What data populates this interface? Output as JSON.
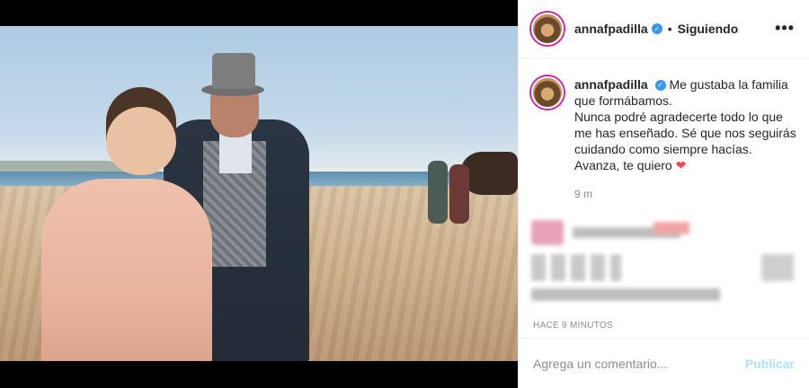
{
  "header": {
    "username": "annafpadilla",
    "separator": "•",
    "follow_label": "Siguiendo",
    "more_label": "•••"
  },
  "caption": {
    "username": "annafpadilla",
    "text": "Me gustaba la familia que formábamos.",
    "text2": "Nunca podré agradecerte todo lo que me has enseñado. Sé que nos seguirás cuidando como siempre hacías. Avanza, te quiero",
    "heart": "❤",
    "time_small": "9 m"
  },
  "post": {
    "time_full": "Hace 9 minutos"
  },
  "comment": {
    "placeholder": "Agrega un comentario...",
    "publish_label": "Publicar"
  },
  "colors": {
    "verified": "#3897f0",
    "publish_disabled": "#b2dffc",
    "heart": "#ed4956"
  }
}
